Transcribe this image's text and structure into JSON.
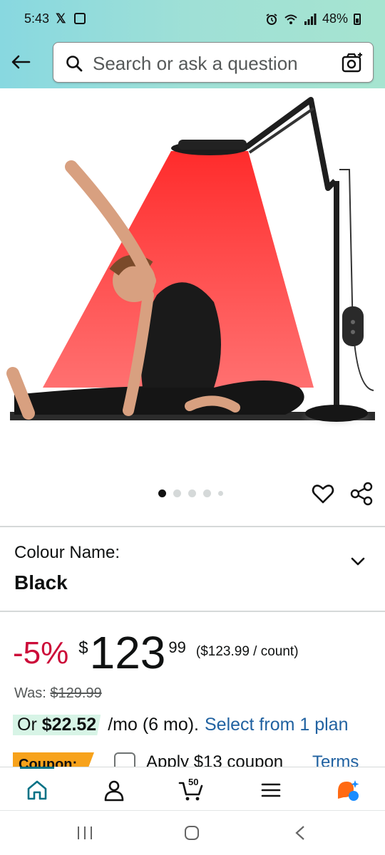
{
  "status_bar": {
    "time": "5:43",
    "x_glyph": "𝕏",
    "battery": "48%"
  },
  "search": {
    "placeholder": "Search or ask a question"
  },
  "carousel": {
    "total": 5,
    "active": 1
  },
  "colour": {
    "label": "Colour Name:",
    "value": "Black"
  },
  "price": {
    "discount": "-5%",
    "currency": "$",
    "whole": "123",
    "fraction": "99",
    "unit_price": "($123.99 / count)",
    "was_label": "Was:",
    "was_price": "$129.99"
  },
  "plan": {
    "or_label": "Or",
    "monthly": "$22.52",
    "term": "/mo (6 mo).",
    "link": "Select from 1 plan"
  },
  "coupon": {
    "badge": "Coupon:",
    "text": "Apply $13 coupon",
    "terms": "Terms"
  },
  "bottom_nav": {
    "cart_count": "50"
  },
  "colors": {
    "accent": "#007185",
    "deal_red": "#cc0c39",
    "link_blue": "#2162a1",
    "coupon_orange": "#f7a21b"
  }
}
